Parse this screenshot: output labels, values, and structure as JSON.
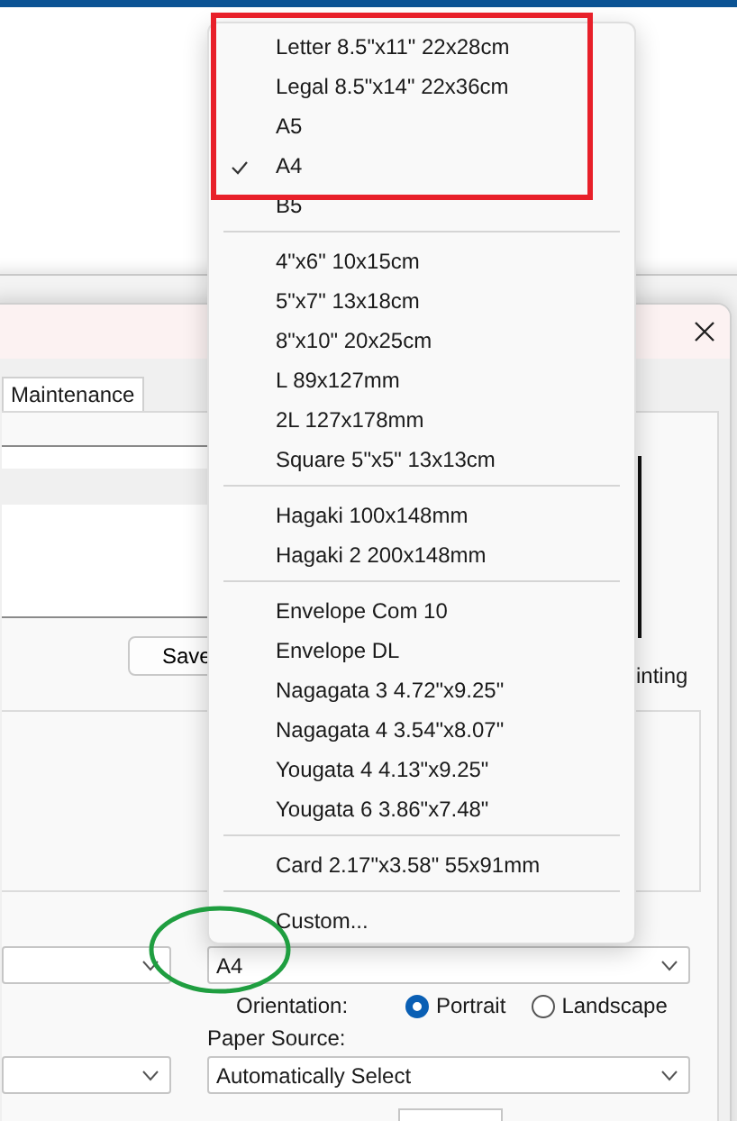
{
  "dialog": {
    "tabs": [
      {
        "label": "Maintenance",
        "selected": true
      }
    ],
    "buttons": [
      "Save"
    ],
    "preview_caption": "inting",
    "paper_size": {
      "value": "A4"
    },
    "orientation": {
      "label": "Orientation:",
      "options": [
        {
          "label": "Portrait",
          "selected": true
        },
        {
          "label": "Landscape",
          "selected": false
        }
      ]
    },
    "paper_source": {
      "label": "Paper Source:",
      "value": "Automatically Select"
    }
  },
  "menu": {
    "groups": [
      [
        {
          "label": "Letter 8.5\"x11\" 22x28cm",
          "checked": false
        },
        {
          "label": "Legal 8.5\"x14\" 22x36cm",
          "checked": false
        },
        {
          "label": "A5",
          "checked": false
        },
        {
          "label": "A4",
          "checked": true
        },
        {
          "label": "B5",
          "checked": false
        }
      ],
      [
        {
          "label": "4\"x6\" 10x15cm",
          "checked": false
        },
        {
          "label": "5\"x7\" 13x18cm",
          "checked": false
        },
        {
          "label": "8\"x10\" 20x25cm",
          "checked": false
        },
        {
          "label": "L 89x127mm",
          "checked": false
        },
        {
          "label": "2L 127x178mm",
          "checked": false
        },
        {
          "label": "Square 5\"x5\" 13x13cm",
          "checked": false
        }
      ],
      [
        {
          "label": "Hagaki 100x148mm",
          "checked": false
        },
        {
          "label": "Hagaki 2 200x148mm",
          "checked": false
        }
      ],
      [
        {
          "label": "Envelope Com 10",
          "checked": false
        },
        {
          "label": "Envelope DL",
          "checked": false
        },
        {
          "label": "Nagagata 3 4.72\"x9.25\"",
          "checked": false
        },
        {
          "label": "Nagagata 4 3.54\"x8.07\"",
          "checked": false
        },
        {
          "label": "Yougata 4 4.13\"x9.25\"",
          "checked": false
        },
        {
          "label": "Yougata 6 3.86\"x7.48\"",
          "checked": false
        }
      ],
      [
        {
          "label": "Card 2.17\"x3.58\" 55x91mm",
          "checked": false
        }
      ],
      [
        {
          "label": "Custom...",
          "checked": false
        }
      ]
    ]
  },
  "annotations": [
    {
      "kind": "rectangle",
      "color": "#e8202a"
    },
    {
      "kind": "ellipse",
      "color": "#1f9e40"
    }
  ]
}
